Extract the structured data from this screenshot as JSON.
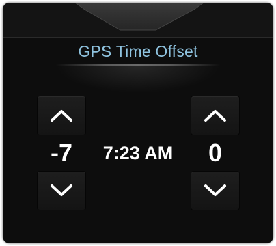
{
  "dialog": {
    "title": "GPS Time Offset"
  },
  "hours": {
    "value": "-7",
    "increment_icon": "chevron-up-icon",
    "decrement_icon": "chevron-down-icon"
  },
  "time": {
    "value": "7:23 AM"
  },
  "minutes": {
    "value": "0",
    "increment_icon": "chevron-up-icon",
    "decrement_icon": "chevron-down-icon"
  },
  "colors": {
    "title": "#8fc3df",
    "background": "#0d0d0d",
    "value_text": "#ffffff"
  }
}
